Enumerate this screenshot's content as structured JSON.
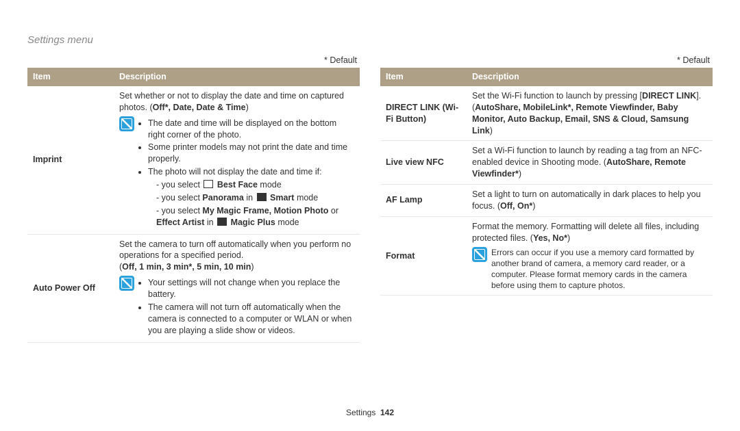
{
  "header": "Settings menu",
  "default_label": "* Default",
  "th_item": "Item",
  "th_desc": "Description",
  "footer": {
    "section": "Settings",
    "page": "142"
  },
  "left": {
    "imprint": {
      "name": "Imprint",
      "line1": "Set whether or not to display the date and time on captured photos. (",
      "opts": "Off*, Date, Date & Time",
      "close": ")",
      "b1": "The date and time will be displayed on the bottom right corner of the photo.",
      "b2": "Some printer models may not print the date and time properly.",
      "b3": "The photo will not display the date and time if:",
      "d1a": "you select ",
      "d1b": "Best Face",
      "d1c": " mode",
      "d2a": "you select ",
      "d2b": "Panorama",
      "d2c": " in ",
      "d2d": "Smart",
      "d2e": " mode",
      "d3a": "you select ",
      "d3b": "My Magic Frame, Motion Photo",
      "d3c": " or ",
      "d3d": "Effect Artist",
      "d3e": " in ",
      "d3f": "Magic Plus",
      "d3g": " mode"
    },
    "apo": {
      "name": "Auto Power Off",
      "line1": "Set the camera to turn off automatically when you perform no operations for a specified period.",
      "opts": "Off, 1 min, 3 min*, 5 min, 10 min",
      "b1": "Your settings will not change when you replace the battery.",
      "b2": "The camera will not turn off automatically when the camera is connected to a computer or WLAN or when you are playing a slide show or videos."
    }
  },
  "right": {
    "dlink": {
      "name": "DIRECT LINK (Wi-Fi Button)",
      "t1": "Set the Wi-Fi function to launch by pressing [",
      "t2": "DIRECT LINK",
      "t3": "]. (",
      "opts": "AutoShare, MobileLink*, Remote Viewfinder, Baby Monitor, Auto Backup, Email, SNS & Cloud, Samsung Link",
      "close": ")"
    },
    "nfc": {
      "name": "Live view NFC",
      "t1": "Set a Wi-Fi function to launch by reading a tag from an NFC-enabled device in Shooting mode. (",
      "t2": "AutoShare, Remote Viewfinder*",
      "close": ")"
    },
    "af": {
      "name": "AF Lamp",
      "t1": "Set a light to turn on automatically in dark places to help you focus. (",
      "opts": "Off, On*",
      "close": ")"
    },
    "fmt": {
      "name": "Format",
      "t1": "Format the memory. Formatting will delete all files, including protected files. (",
      "opts": "Yes, No*",
      "close": ")",
      "note": "Errors can occur if you use a memory card formatted by another brand of camera, a memory card reader, or a computer. Please format memory cards in the camera before using them to capture photos."
    }
  }
}
